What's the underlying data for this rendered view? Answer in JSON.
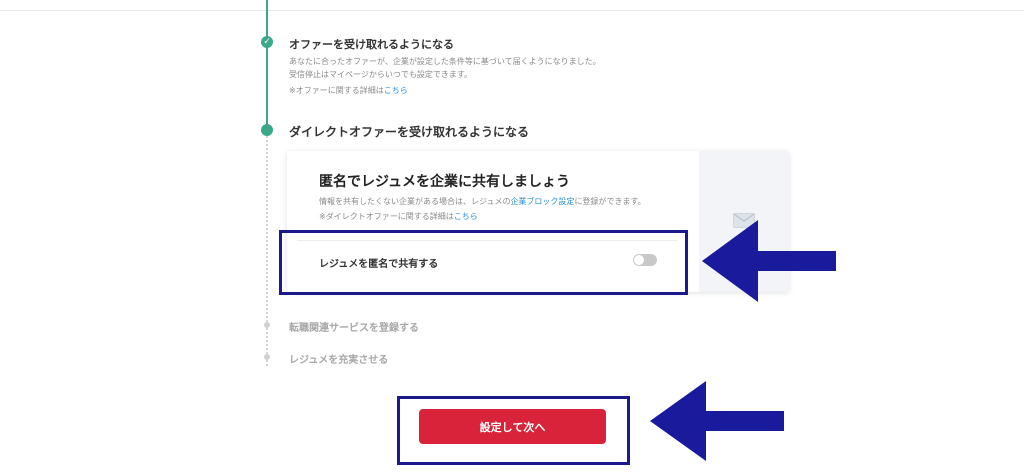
{
  "steps": {
    "offer": {
      "title": "オファーを受け取れるようになる",
      "desc_line1": "あなたに合ったオファーが、企業が設定した条件等に基づいて届くようになりました。",
      "desc_line2": "受信停止はマイページからいつでも設定できます。",
      "note_prefix": "※オファーに関する詳細は",
      "note_link": "こちら"
    },
    "direct_offer": {
      "title": "ダイレクトオファーを受け取れるようになる"
    },
    "services": {
      "title": "転職関連サービスを登録する"
    },
    "resume": {
      "title": "レジュメを充実させる"
    }
  },
  "card": {
    "title": "匿名でレジュメを企業に共有しましょう",
    "desc_prefix": "情報を共有したくない企業がある場合は、レジュメの",
    "desc_link": "企業ブロック設定",
    "desc_suffix": "に登録ができます。",
    "note_prefix": "※ダイレクトオファーに関する詳細は",
    "note_link": "こちら",
    "toggle_label": "レジュメを匿名で共有する",
    "toggle_state": "off",
    "icon": "mail-icon"
  },
  "submit": {
    "label": "設定して次へ"
  },
  "colors": {
    "accent_green": "#3aa88a",
    "button_red": "#d8233a",
    "annotation_blue": "#1a1a8c",
    "link_blue": "#2a8fd6"
  }
}
